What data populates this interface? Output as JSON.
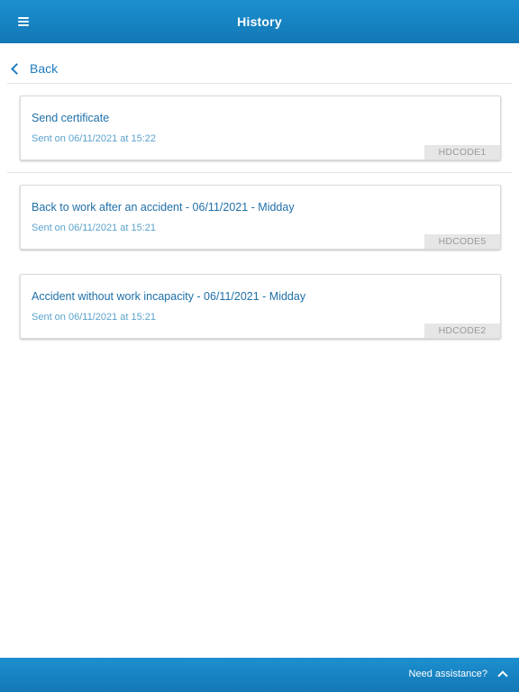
{
  "header": {
    "title": "History",
    "menu_icon": "hamburger-menu-icon"
  },
  "nav": {
    "back_label": "Back",
    "back_icon": "chevron-left-icon"
  },
  "history": [
    {
      "title": "Send certificate",
      "sent": "Sent on 06/11/2021 at 15:22",
      "code": "HDCODE1"
    },
    {
      "title": "Back to work after an accident - 06/11/2021 - Midday",
      "sent": "Sent on 06/11/2021 at 15:21",
      "code": "HDCODE5"
    },
    {
      "title": "Accident without work incapacity - 06/11/2021 - Midday",
      "sent": "Sent on 06/11/2021 at 15:21",
      "code": "HDCODE2"
    }
  ],
  "footer": {
    "assistance_label": "Need assistance?",
    "expand_icon": "chevron-up-icon"
  },
  "colors": {
    "header_bar": "#1a87c8",
    "link_text": "#1f6fa8",
    "secondary_text": "#5aa2cc",
    "code_badge": "#e6e6e6"
  }
}
